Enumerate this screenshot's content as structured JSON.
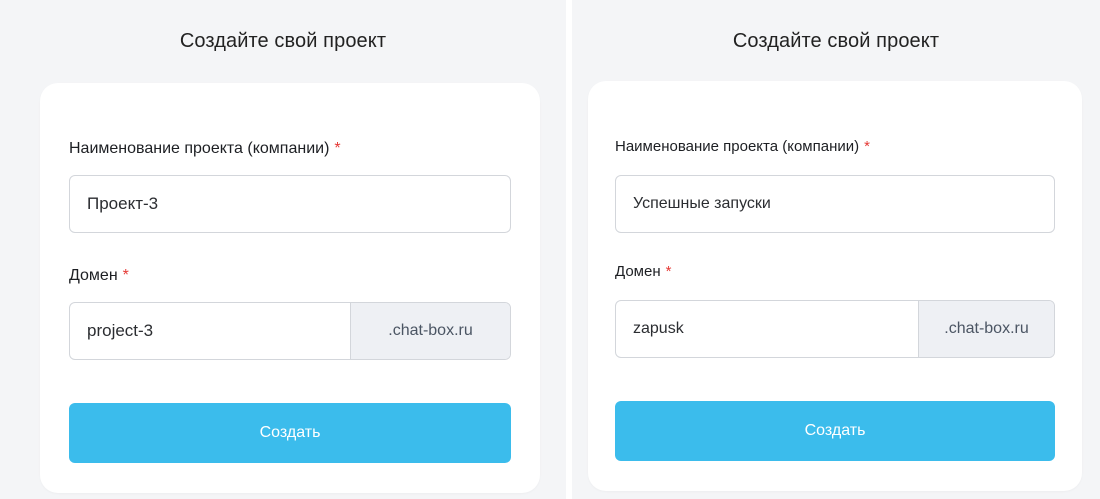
{
  "left": {
    "title": "Создайте свой проект",
    "name_label": "Наименование проекта (компании)",
    "required_mark": "*",
    "name_value": "Проект-3",
    "domain_label": "Домен",
    "domain_value": "project-3",
    "domain_suffix": ".chat-box.ru",
    "submit_label": "Создать"
  },
  "right": {
    "title": "Создайте свой проект",
    "name_label": "Наименование проекта (компании)",
    "required_mark": "*",
    "name_value": "Успешные запуски",
    "domain_label": "Домен",
    "domain_value": "zapusk",
    "domain_suffix": ".chat-box.ru",
    "submit_label": "Создать"
  },
  "colors": {
    "accent": "#3bbcec",
    "required": "#e53935",
    "background": "#f4f5f7"
  }
}
